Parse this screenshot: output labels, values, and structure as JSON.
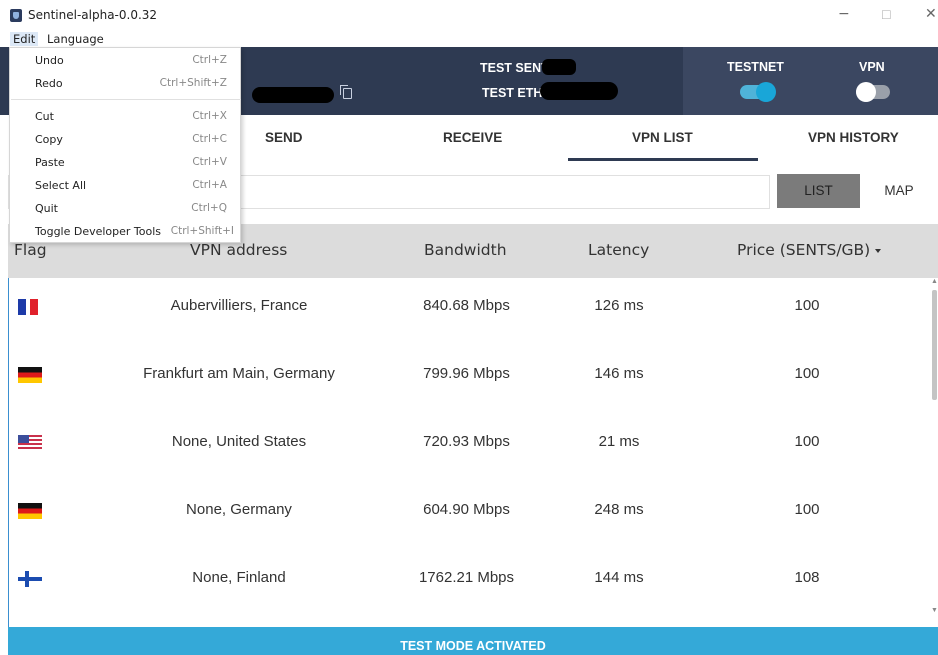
{
  "window": {
    "title": "Sentinel-alpha-0.0.32",
    "controls": {
      "minimize": "−",
      "maximize": "☐",
      "close": "✕"
    }
  },
  "menubar": {
    "edit": "Edit",
    "language": "Language"
  },
  "edit_menu": {
    "items": [
      {
        "label": "Undo",
        "shortcut": "Ctrl+Z"
      },
      {
        "label": "Redo",
        "shortcut": "Ctrl+Shift+Z"
      },
      {
        "label": "Cut",
        "shortcut": "Ctrl+X"
      },
      {
        "label": "Copy",
        "shortcut": "Ctrl+C"
      },
      {
        "label": "Paste",
        "shortcut": "Ctrl+V"
      },
      {
        "label": "Select All",
        "shortcut": "Ctrl+A"
      },
      {
        "label": "Quit",
        "shortcut": "Ctrl+Q"
      },
      {
        "label": "Toggle Developer Tools",
        "shortcut": "Ctrl+Shift+I"
      }
    ]
  },
  "header": {
    "test_sent_label": "TEST SENT:",
    "test_eth_label": "TEST ETH:",
    "testnet_label": "TESTNET",
    "vpn_label": "VPN",
    "testnet_on": true,
    "vpn_on": false,
    "accent": "#19a6d8",
    "background": "#2e3a52"
  },
  "tabs": {
    "send": "SEND",
    "receive": "RECEIVE",
    "vpn_list": "VPN LIST",
    "vpn_history": "VPN HISTORY",
    "active": "VPN LIST"
  },
  "view_toggle": {
    "list": "LIST",
    "map": "MAP",
    "active": "LIST"
  },
  "table": {
    "columns": {
      "flag": "Flag",
      "address": "VPN address",
      "bandwidth": "Bandwidth",
      "latency": "Latency",
      "price": "Price (SENTS/GB)"
    },
    "rows": [
      {
        "flag": "france-flag-icon",
        "address": "Aubervilliers, France",
        "bandwidth": "840.68 Mbps",
        "latency": "126 ms",
        "price": "100"
      },
      {
        "flag": "germany-flag-icon",
        "address": "Frankfurt am Main, Germany",
        "bandwidth": "799.96 Mbps",
        "latency": "146 ms",
        "price": "100"
      },
      {
        "flag": "usa-flag-icon",
        "address": "None, United States",
        "bandwidth": "720.93 Mbps",
        "latency": "21 ms",
        "price": "100"
      },
      {
        "flag": "germany-flag-icon",
        "address": "None, Germany",
        "bandwidth": "604.90 Mbps",
        "latency": "248 ms",
        "price": "100"
      },
      {
        "flag": "finland-flag-icon",
        "address": "None, Finland",
        "bandwidth": "1762.21 Mbps",
        "latency": "144 ms",
        "price": "108"
      }
    ]
  },
  "footer": {
    "text": "TEST MODE ACTIVATED",
    "color": "#34a9d8"
  }
}
